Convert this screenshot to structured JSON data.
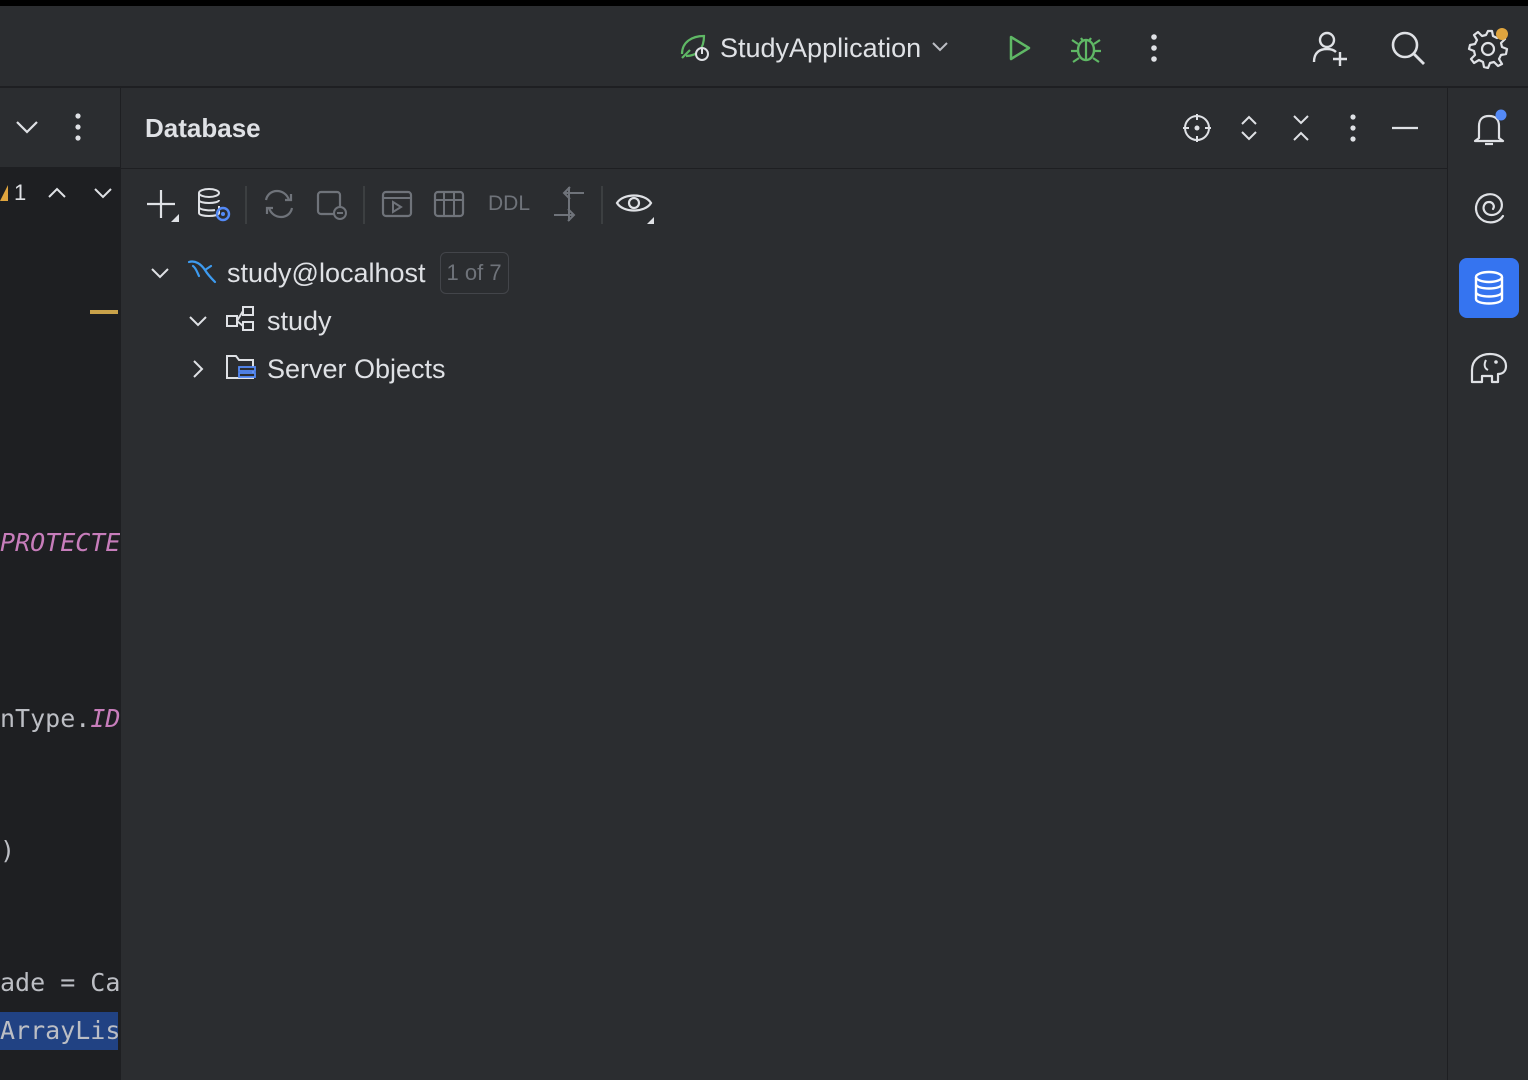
{
  "run_config": {
    "name": "StudyApplication",
    "icon": "spring-boot-run-config-icon"
  },
  "titlebar_actions": [
    {
      "name": "run-icon",
      "color": "#5fb865"
    },
    {
      "name": "debug-icon",
      "color": "#5fb865"
    },
    {
      "name": "more-vertical-icon"
    },
    {
      "name": "add-user-icon"
    },
    {
      "name": "search-icon"
    },
    {
      "name": "settings-icon",
      "notification_dot": "#e0a53e"
    }
  ],
  "editor": {
    "warnings_count": "1",
    "code_lines": [
      "PROTECTE",
      "nType.",
      "ID",
      ")",
      "ade = Ca",
      "ArrayLis"
    ]
  },
  "panel": {
    "title": "Database",
    "header_actions": [
      "locate-icon",
      "expand-all-icon",
      "collapse-all-icon",
      "more-options-icon",
      "hide-panel-icon"
    ],
    "toolbar": {
      "items": [
        "new-icon",
        "data-source-properties-icon",
        "refresh-icon",
        "disconnect-icon",
        "query-console-icon",
        "table-view-icon",
        "ddl-button",
        "jump-to-query-icon",
        "view-options-icon"
      ],
      "ddl_label": "DDL"
    },
    "tree": {
      "connection": {
        "label": "study@localhost",
        "badge": "1 of 7"
      },
      "schema": {
        "label": "study"
      },
      "server_objects": {
        "label": "Server Objects"
      }
    }
  },
  "right_toolbar": [
    {
      "name": "notifications-icon",
      "active": false
    },
    {
      "name": "ai-assistant-icon",
      "active": false
    },
    {
      "name": "database-icon",
      "active": true
    },
    {
      "name": "elephant-icon",
      "active": false
    }
  ],
  "colors": {
    "accent": "#3574f0",
    "panel_bg": "#2b2d30",
    "editor_bg": "#1e1f22",
    "keyword_purple": "#c77dbb",
    "selection": "#214283",
    "run_green": "#5fb865"
  }
}
